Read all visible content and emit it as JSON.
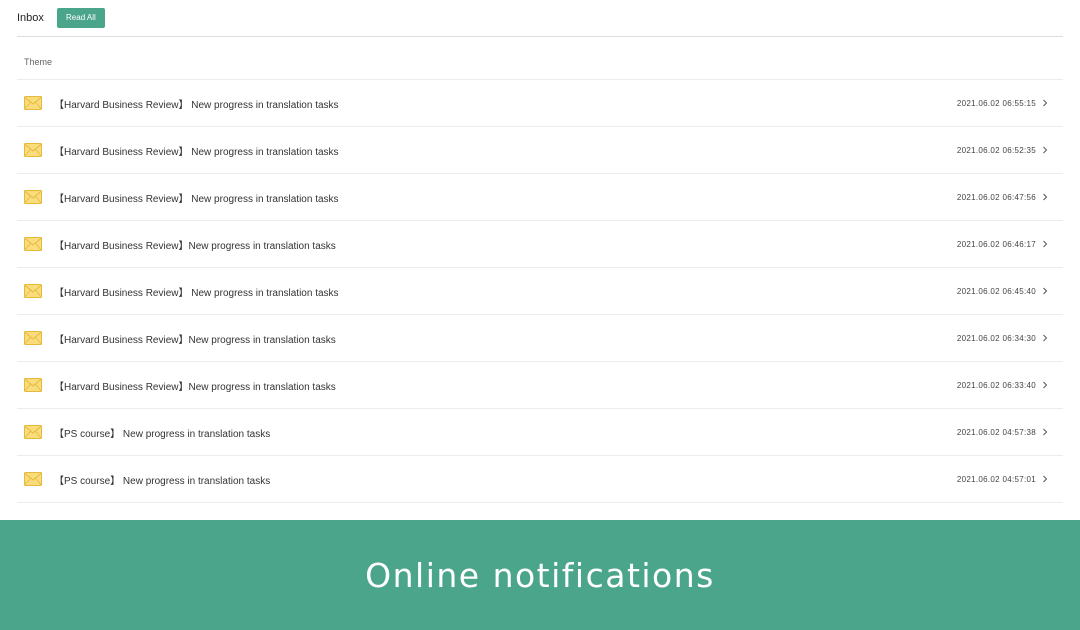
{
  "header": {
    "title": "Inbox",
    "read_all_label": "Read All"
  },
  "list": {
    "column_label": "Theme",
    "icon": "envelope-icon",
    "icon_color": "#f7d46a",
    "rows": [
      {
        "subject": "【Harvard Business Review】 New progress in translation tasks",
        "time": "2021.06.02 06:55:15"
      },
      {
        "subject": "【Harvard Business Review】 New progress in translation tasks",
        "time": "2021.06.02 06:52:35"
      },
      {
        "subject": "【Harvard Business Review】 New progress in translation tasks",
        "time": "2021.06.02 06:47:56"
      },
      {
        "subject": "【Harvard Business Review】New progress in translation tasks",
        "time": "2021.06.02 06:46:17"
      },
      {
        "subject": "【Harvard Business Review】 New progress in translation tasks",
        "time": "2021.06.02 06:45:40"
      },
      {
        "subject": "【Harvard Business Review】New progress in translation tasks",
        "time": "2021.06.02 06:34:30"
      },
      {
        "subject": "【Harvard Business Review】New progress in translation tasks",
        "time": "2021.06.02 06:33:40"
      },
      {
        "subject": "【PS course】 New progress in translation tasks",
        "time": "2021.06.02 04:57:38"
      },
      {
        "subject": "【PS course】 New progress in translation tasks",
        "time": "2021.06.02 04:57:01"
      }
    ]
  },
  "banner": {
    "text": "Online notifications",
    "color": "#4ba58b"
  }
}
